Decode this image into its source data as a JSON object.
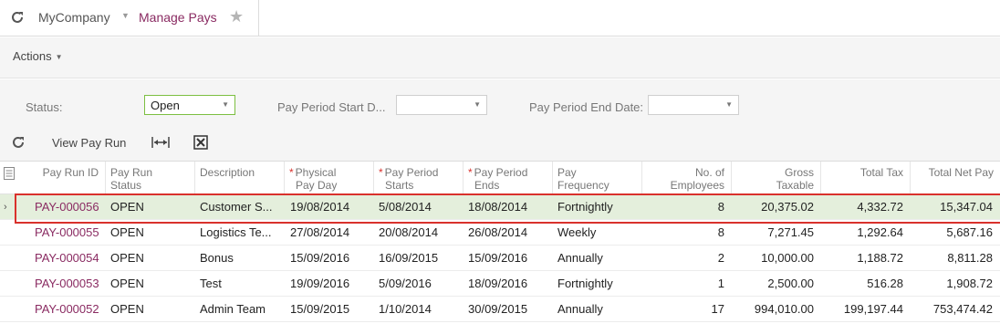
{
  "header": {
    "company": "MyCompany",
    "page_title": "Manage Pays"
  },
  "toolbar": {
    "actions_label": "Actions"
  },
  "filters": {
    "status_label": "Status:",
    "status_value": "Open",
    "start_label": "Pay Period Start D...",
    "start_value": "",
    "end_label": "Pay Period End Date:",
    "end_value": ""
  },
  "grid_toolbar": {
    "view_pay_run_label": "View Pay Run"
  },
  "columns": [
    {
      "line1": "Pay Run ID",
      "line2": "",
      "required": false
    },
    {
      "line1": "Pay Run",
      "line2": "Status",
      "required": false
    },
    {
      "line1": "Description",
      "line2": "",
      "required": false
    },
    {
      "line1": "Physical",
      "line2": "Pay Day",
      "required": true
    },
    {
      "line1": "Pay Period",
      "line2": "Starts",
      "required": true
    },
    {
      "line1": "Pay Period",
      "line2": "Ends",
      "required": true
    },
    {
      "line1": "Pay",
      "line2": "Frequency",
      "required": false
    },
    {
      "line1": "No. of",
      "line2": "Employees",
      "required": false
    },
    {
      "line1": "Gross",
      "line2": "Taxable",
      "required": false
    },
    {
      "line1": "Total Tax",
      "line2": "",
      "required": false
    },
    {
      "line1": "Total Net Pay",
      "line2": "",
      "required": false
    }
  ],
  "rows": [
    [
      "PAY-000056",
      "OPEN",
      "Customer S...",
      "19/08/2014",
      "5/08/2014",
      "18/08/2014",
      "Fortnightly",
      "8",
      "20,375.02",
      "4,332.72",
      "15,347.04"
    ],
    [
      "PAY-000055",
      "OPEN",
      "Logistics Te...",
      "27/08/2014",
      "20/08/2014",
      "26/08/2014",
      "Weekly",
      "8",
      "7,271.45",
      "1,292.64",
      "5,687.16"
    ],
    [
      "PAY-000054",
      "OPEN",
      "Bonus",
      "15/09/2016",
      "16/09/2015",
      "15/09/2016",
      "Annually",
      "2",
      "10,000.00",
      "1,188.72",
      "8,811.28"
    ],
    [
      "PAY-000053",
      "OPEN",
      "Test",
      "19/09/2016",
      "5/09/2016",
      "18/09/2016",
      "Fortnightly",
      "1",
      "2,500.00",
      "516.28",
      "1,908.72"
    ],
    [
      "PAY-000052",
      "OPEN",
      "Admin Team",
      "15/09/2015",
      "1/10/2014",
      "30/09/2015",
      "Annually",
      "17",
      "994,010.00",
      "199,197.44",
      "753,474.42"
    ]
  ],
  "selected_row": 0
}
